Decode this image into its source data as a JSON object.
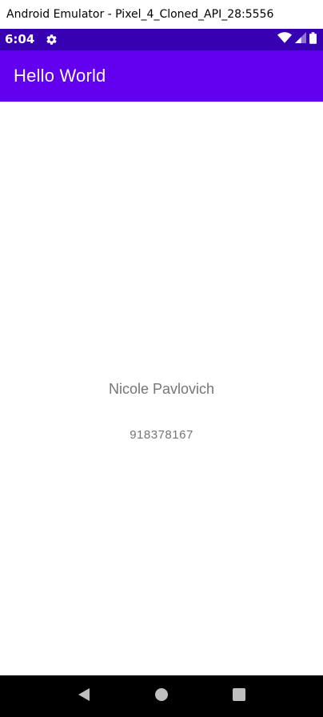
{
  "window": {
    "title": "Android Emulator - Pixel_4_Cloned_API_28:5556"
  },
  "status_bar": {
    "time": "6:04",
    "icons": [
      "gear-icon",
      "wifi-icon",
      "signal-icon",
      "battery-icon"
    ],
    "background": "#3700b3"
  },
  "app_bar": {
    "title": "Hello World",
    "background": "#6200ee"
  },
  "content": {
    "name": "Nicole Pavlovich",
    "phone": "918378167",
    "text_color": "#757575"
  },
  "nav_bar": {
    "buttons": [
      "back-icon",
      "home-icon",
      "recents-icon"
    ],
    "background": "#000000"
  }
}
